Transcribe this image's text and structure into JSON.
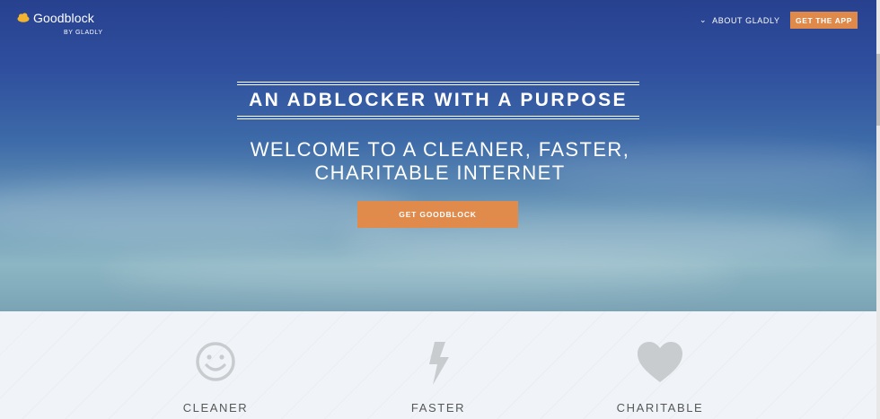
{
  "header": {
    "brand_name": "Goodblock",
    "brand_sub": "BY GLADLY",
    "nav_about": "ABOUT GLADLY",
    "nav_cta": "GET THE APP"
  },
  "hero": {
    "tagline": "AN ADBLOCKER WITH A PURPOSE",
    "welcome_line1": "WELCOME TO A CLEANER, FASTER,",
    "welcome_line2": "CHARITABLE INTERNET",
    "cta_label": "GET GOODBLOCK"
  },
  "features": [
    {
      "icon": "smiley-icon",
      "label": "CLEANER"
    },
    {
      "icon": "lightning-icon",
      "label": "FASTER"
    },
    {
      "icon": "heart-icon",
      "label": "CHARITABLE"
    }
  ],
  "colors": {
    "accent": "#df8a4a",
    "icon_gray": "#c9cccf",
    "feature_bg": "#f0f4f8"
  }
}
